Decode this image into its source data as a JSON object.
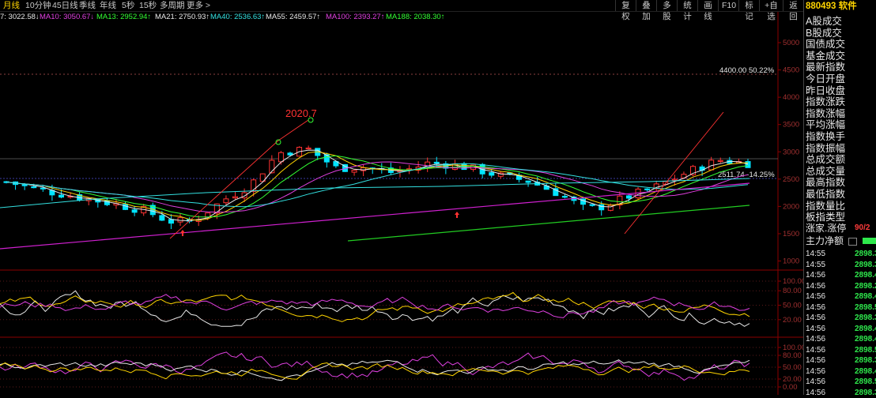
{
  "toolbar": {
    "periods": [
      {
        "label": "月线",
        "active": true
      },
      {
        "label": "10分钟"
      },
      {
        "label": "45日线"
      },
      {
        "label": "季线"
      },
      {
        "label": "年线"
      },
      {
        "label": "5秒"
      },
      {
        "label": "15秒"
      },
      {
        "label": "多周期"
      },
      {
        "label": "更多 >"
      }
    ],
    "buttons": [
      "复权",
      "叠加",
      "多股",
      "统计",
      "画线",
      "F10",
      "标记",
      "+自选",
      "返回"
    ]
  },
  "ma_line": [
    {
      "text": "7: 3022.58↓",
      "color": "#e8e8e8"
    },
    {
      "text": "MA10: 3050.67↓",
      "color": "#e040e0"
    },
    {
      "text": "MA13: 2952.94↑",
      "color": "#33ff33"
    },
    {
      "text": "MA21: 2750.93↑",
      "color": "#e8e8e8"
    },
    {
      "text": "MA40: 2536.63↑",
      "color": "#33e0e0"
    },
    {
      "text": "MA55: 2459.57↑",
      "color": "#e8e8e8"
    },
    {
      "text": "MA100: 2393.27↑",
      "color": "#e040e0"
    },
    {
      "text": "MA188: 2038.30↑",
      "color": "#33ff33"
    }
  ],
  "chart": {
    "price_ticks": [
      "5000",
      "4500",
      "4000",
      "3500",
      "3000",
      "2500",
      "2000",
      "1500",
      "1000"
    ],
    "ref_line_label": "4400.00 50.22%",
    "annotation_high": "2020.7",
    "ref_line2_label": "2511.74 -14.25%",
    "ind1_ticks": [
      "100.00",
      "80.00",
      "50.00",
      "20.00"
    ],
    "ind2_ticks": [
      "100.00",
      "80.00",
      "50.00",
      "20.00",
      "0.00"
    ],
    "up_color": "#ff3232",
    "down_color": "#00e4ff"
  },
  "panel": {
    "code": "880493",
    "name": "软件",
    "items": [
      "A股成交",
      "B股成交",
      "国债成交",
      "基金成交",
      "最新指数",
      "今日开盘",
      "昨日收盘",
      "指数涨跌",
      "指数涨幅",
      "平均涨幅",
      "指数换手",
      "指数振幅",
      "总成交额",
      "总成交量",
      "最高指数",
      "最低指数",
      "指数量比",
      "板指类型"
    ],
    "stat1_label": "涨家.涨停",
    "stat1_value": "90/2",
    "stat2_label": "主力净额",
    "ticks": [
      {
        "t": "14:55",
        "p": "2898.3"
      },
      {
        "t": "14:55",
        "p": "2898.3"
      },
      {
        "t": "14:56",
        "p": "2898.4"
      },
      {
        "t": "14:56",
        "p": "2898.2"
      },
      {
        "t": "14:56",
        "p": "2898.4"
      },
      {
        "t": "14:56",
        "p": "2898.5"
      },
      {
        "t": "14:56",
        "p": "2898.3"
      },
      {
        "t": "14:56",
        "p": "2898.4"
      },
      {
        "t": "14:56",
        "p": "2898.4"
      },
      {
        "t": "14:56",
        "p": "2898.5"
      },
      {
        "t": "14:56",
        "p": "2898.3"
      },
      {
        "t": "14:56",
        "p": "2898.4"
      },
      {
        "t": "14:56",
        "p": "2898.5"
      },
      {
        "t": "14:56",
        "p": "2898.3"
      }
    ]
  }
}
